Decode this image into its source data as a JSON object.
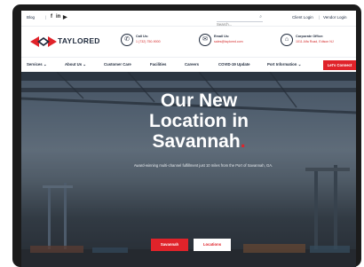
{
  "topbar": {
    "blog": "Blog",
    "social": [
      "f",
      "in",
      "yt"
    ],
    "search_placeholder": "Search...",
    "client_login": "Client Login",
    "divider": "|",
    "vendor_login": "Vendor Login"
  },
  "header": {
    "logo_text": "TAYLORED",
    "call": {
      "label": "Call Us:",
      "value": "1 (732) 750-9000"
    },
    "email": {
      "label": "Email Us:",
      "value": "sales@taylored.com"
    },
    "office": {
      "label": "Corporate Office:",
      "value": "1011 Alfa Road, Edison NJ"
    }
  },
  "nav": {
    "items": [
      "Services ⌄",
      "About Us ⌄",
      "Customer Care",
      "Facilities",
      "Careers",
      "COVID-19 Update",
      "Port Information ⌄"
    ],
    "cta": "Let's Connect"
  },
  "hero": {
    "heading_lines": [
      "Our New",
      "Location in",
      "Savannah"
    ],
    "heading_dot": ".",
    "subtext": "Award-winning multi-channel fulfillment just 10 miles from the Port of Savannah, GA.",
    "primary_button": "Savannah",
    "secondary_button": "Locations"
  },
  "colors": {
    "brand_red": "#e0232a",
    "navy": "#1f2a3c"
  }
}
